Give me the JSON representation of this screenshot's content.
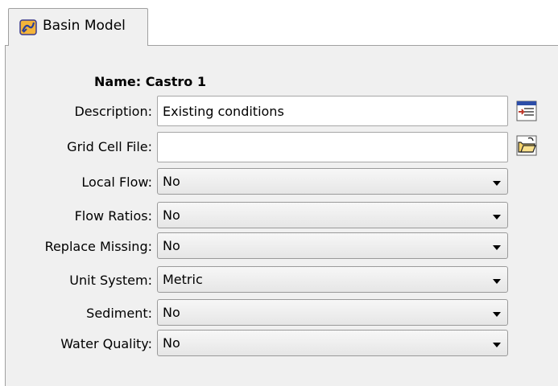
{
  "tab": {
    "label": "Basin Model",
    "icon": "basin-model-icon"
  },
  "form": {
    "name_label": "Name:",
    "name_value": "Castro 1",
    "description_label": "Description:",
    "description_value": "Existing conditions",
    "grid_cell_file_label": "Grid Cell File:",
    "grid_cell_file_value": "",
    "local_flow_label": "Local Flow:",
    "local_flow_value": "No",
    "flow_ratios_label": "Flow Ratios:",
    "flow_ratios_value": "No",
    "replace_missing_label": "Replace Missing:",
    "replace_missing_value": "No",
    "unit_system_label": "Unit System:",
    "unit_system_value": "Metric",
    "sediment_label": "Sediment:",
    "sediment_value": "No",
    "water_quality_label": "Water Quality:",
    "water_quality_value": "No"
  },
  "icons": {
    "description_editor": "edit-description-icon",
    "grid_file_browse": "open-folder-icon"
  }
}
